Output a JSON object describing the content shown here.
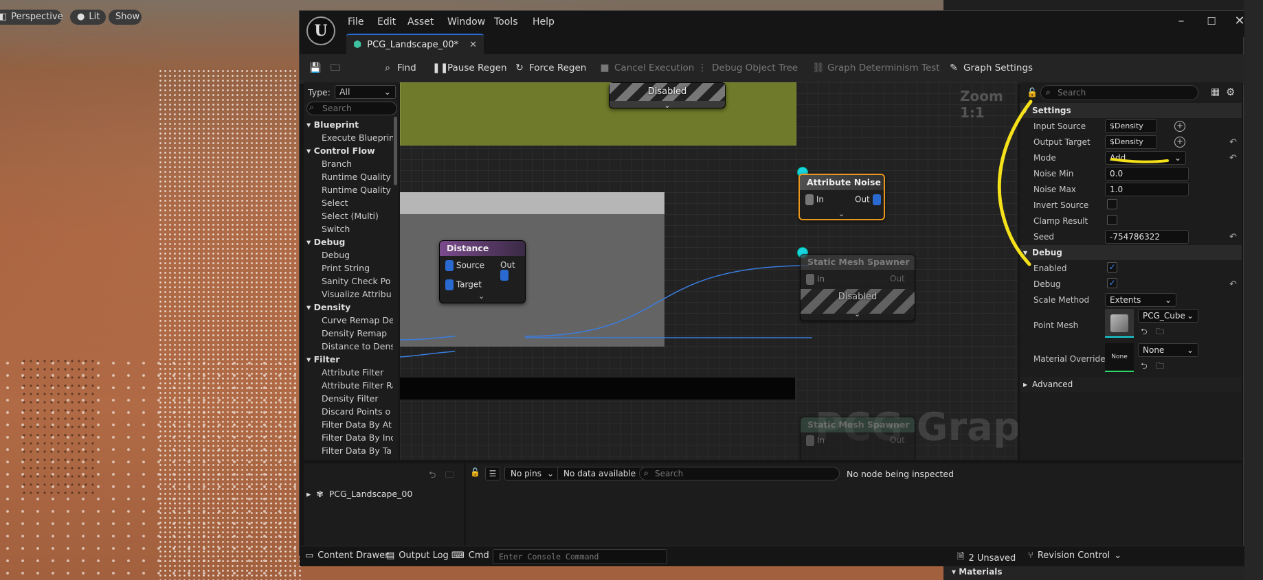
{
  "viewport": {
    "perspective": "Perspective",
    "lit": "Lit",
    "show": "Show"
  },
  "editor": {
    "menu": [
      "File",
      "Edit",
      "Asset",
      "Window",
      "Tools",
      "Help"
    ],
    "tab": "PCG_Landscape_00*",
    "toolbar": {
      "find": "Find",
      "pause": "Pause Regen",
      "force": "Force Regen",
      "cancel": "Cancel Execution",
      "debug_tree": "Debug Object Tree",
      "determinism": "Graph Determinism Test",
      "settings": "Graph Settings"
    },
    "palette": {
      "type_label": "Type:",
      "type_value": "All",
      "search_placeholder": "Search",
      "categories": [
        {
          "name": "Blueprint",
          "items": [
            "Execute Blueprint"
          ]
        },
        {
          "name": "Control Flow",
          "items": [
            "Branch",
            "Runtime Quality",
            "Runtime Quality",
            "Select",
            "Select (Multi)",
            "Switch"
          ]
        },
        {
          "name": "Debug",
          "items": [
            "Debug",
            "Print String",
            "Sanity Check Po",
            "Visualize Attribu"
          ]
        },
        {
          "name": "Density",
          "items": [
            "Curve Remap De",
            "Density Remap",
            "Distance to Dens"
          ]
        },
        {
          "name": "Filter",
          "items": [
            "Attribute Filter",
            "Attribute Filter Ra",
            "Density Filter",
            "Discard Points o",
            "Filter Data By At",
            "Filter Data By Ind",
            "Filter Data By Ta"
          ]
        }
      ]
    },
    "graph": {
      "zoom": "Zoom 1:1",
      "watermark": "PCG Graph",
      "disabled": "Disabled",
      "distance_node": {
        "title": "Distance",
        "pin_source": "Source",
        "pin_target": "Target",
        "pin_out": "Out"
      },
      "noise_node": {
        "title": "Attribute Noise",
        "pin_in": "In",
        "pin_out": "Out"
      },
      "spawner1": {
        "title": "Static Mesh Spawner",
        "pin_in": "In",
        "pin_out": "Out",
        "status": "Disabled"
      },
      "spawner2": {
        "title": "Static Mesh Spawner",
        "pin_in": "In",
        "pin_out": "Out"
      }
    },
    "details": {
      "search_placeholder": "Search",
      "settings_section": "Settings",
      "input_source_label": "Input Source",
      "input_source": "$Density",
      "output_target_label": "Output Target",
      "output_target": "$Density",
      "mode_label": "Mode",
      "mode": "Add",
      "noise_min_label": "Noise Min",
      "noise_min": "0.0",
      "noise_max_label": "Noise Max",
      "noise_max": "1.0",
      "invert_label": "Invert Source",
      "clamp_label": "Clamp Result",
      "seed_label": "Seed",
      "seed": "-754786322",
      "debug_section": "Debug",
      "enabled_label": "Enabled",
      "debug_label": "Debug",
      "scale_label": "Scale Method",
      "scale": "Extents",
      "point_mesh_label": "Point Mesh",
      "point_mesh": "PCG_Cube",
      "material_label": "Material Override",
      "material": "None",
      "material_thumb": "None",
      "advanced_section": "Advanced"
    },
    "bottom": {
      "tree_item": "PCG_Landscape_00",
      "no_pins": "No pins",
      "no_data": "No data available",
      "search_placeholder": "Search",
      "status": "No node being inspected"
    },
    "statusbar": {
      "content_drawer": "Content Drawer",
      "output_log": "Output Log",
      "cmd": "Cmd",
      "console_placeholder": "Enter Console Command",
      "unsaved": "2 Unsaved",
      "revision": "Revision Control"
    }
  },
  "right_panel": {
    "materials": "Materials"
  },
  "colors": {
    "accent": "#2a6ad0",
    "noise_border": "#e8961e",
    "reroute": "#17d5e0",
    "annotation": "#f5e11a",
    "distance_head": "#7a4a8c"
  }
}
